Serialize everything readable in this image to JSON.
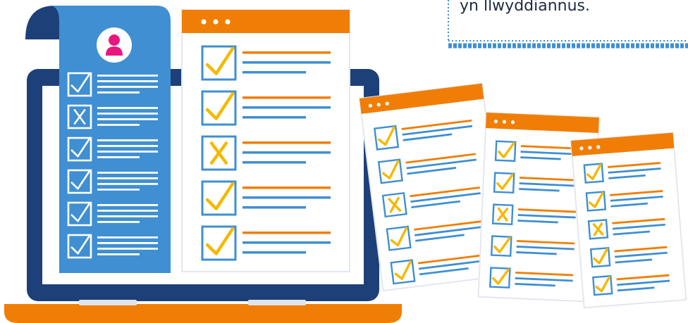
{
  "callout": {
    "text": "yn llwyddiannus."
  },
  "colors": {
    "laptop_dark": "#1d4078",
    "laptop_base": "#f07e06",
    "scroll_blue": "#3f8fd2",
    "scroll_dark": "#1d4078",
    "window_bar": "#f07e06",
    "check": "#f5b800",
    "box_border": "#3f8fd2",
    "line_orange": "#f07e06",
    "line_blue": "#3f8fd2",
    "avatar": "#e8177d",
    "dash_blue": "#3f8fd2"
  },
  "icons": {
    "avatar": "user-icon",
    "check": "checkmark-icon",
    "cross": "x-mark-icon",
    "window_dots": "window-dots-icon"
  },
  "resume_items": [
    "check",
    "x",
    "check",
    "check",
    "check",
    "check"
  ],
  "main_window_items": [
    "check",
    "check",
    "x",
    "check",
    "check"
  ],
  "side_windows": [
    {
      "items": [
        "check",
        "check",
        "x",
        "check",
        "check"
      ]
    },
    {
      "items": [
        "check",
        "check",
        "x",
        "check",
        "check"
      ]
    },
    {
      "items": [
        "check",
        "check",
        "x",
        "check",
        "check"
      ]
    }
  ]
}
